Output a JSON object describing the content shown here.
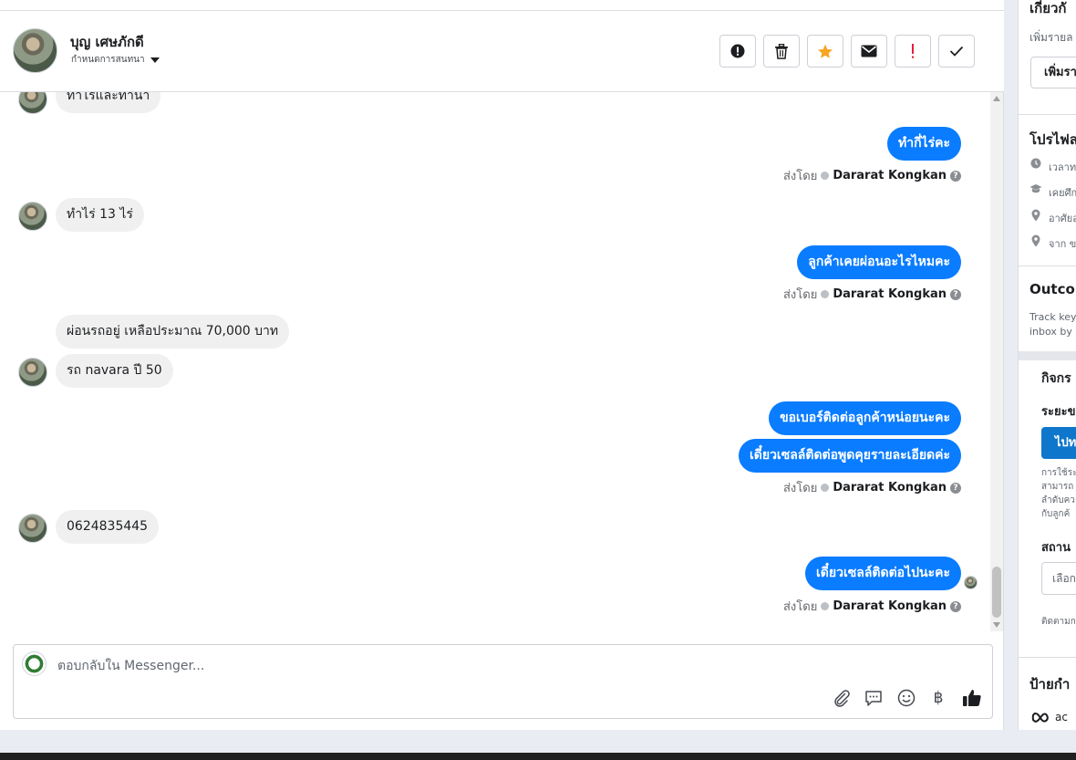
{
  "header": {
    "contact_name": "บุญ เศษภักดี",
    "assign_label": "กำหนดการสนทนา"
  },
  "header_actions": [
    {
      "name": "mark-spam-button",
      "icon": "alert-circle-icon"
    },
    {
      "name": "delete-button",
      "icon": "trash-icon"
    },
    {
      "name": "star-button",
      "icon": "star-icon"
    },
    {
      "name": "mark-unread-button",
      "icon": "envelope-icon"
    },
    {
      "name": "follow-up-button",
      "icon": "exclamation-icon"
    },
    {
      "name": "mark-done-button",
      "icon": "check-icon"
    }
  ],
  "messages": [
    {
      "dir": "in",
      "text": "ทำไรและทำนา"
    },
    {
      "dir": "out",
      "text": "ทำกี่ไร่คะ"
    },
    {
      "dir": "in",
      "text": "ทำไร่ 13 ไร่"
    },
    {
      "dir": "out",
      "text": "ลูกค้าเคยผ่อนอะไรไหมคะ"
    },
    {
      "dir": "in",
      "text": "ผ่อนรถอยู่ เหลือประมาณ 70,000 บาท"
    },
    {
      "dir": "in",
      "text": "รถ navara ปี 50"
    },
    {
      "dir": "out",
      "text": "ขอเบอร์ติดต่อลูกค้าหน่อยนะคะ"
    },
    {
      "dir": "out",
      "text": "เดี๋ยวเซลล์ติดต่อพูดคุยรายละเอียดค่ะ"
    },
    {
      "dir": "in",
      "text": "0624835445"
    },
    {
      "dir": "out",
      "text": "เดี๋ยวเซลล์ติดต่อไปนะคะ"
    }
  ],
  "sent_by": {
    "prefix": "ส่งโดย",
    "agent": "Dararat Kongkan"
  },
  "composer": {
    "placeholder": "ตอบกลับใน Messenger...",
    "tools": [
      "paperclip-icon",
      "chat-bubble-icon",
      "emoji-icon",
      "baht-icon",
      "thumbs-up-icon"
    ],
    "baht_symbol": "฿"
  },
  "right_panel": {
    "about_title": "เกี่ยวกั",
    "about_sub": "เพิ่มรายล",
    "about_button": "เพิ่มรา",
    "profile_title": "โปรไฟล",
    "profile_items": [
      {
        "icon": "clock-icon",
        "text": "เวลาท"
      },
      {
        "icon": "graduation-cap-icon",
        "text": "เคยศึก"
      },
      {
        "icon": "location-pin-icon",
        "text": "อาศัยอ"
      },
      {
        "icon": "location-pin-icon",
        "text": "จาก ข"
      }
    ],
    "outcome_title": "Outcon",
    "outcome_desc_1": "Track key",
    "outcome_desc_2": "inbox by ",
    "activity_title": "กิจกร",
    "stage_label": "ระยะข",
    "go_button": "ไปท",
    "desc_lines": [
      "การใช้ระ",
      "สามารถ",
      "ลำดับคว",
      "กับลูกค้"
    ],
    "status_label": "สถาน",
    "status_select": "เลือก",
    "follow_text": "ติดตามก",
    "labels_title": "ป้ายกำ",
    "meta_tag": "ac"
  },
  "colors": {
    "accent_blue": "#0a7cff",
    "button_blue": "#0e77cc",
    "star_orange": "#f5a623",
    "alert_red": "#e41e3f"
  }
}
